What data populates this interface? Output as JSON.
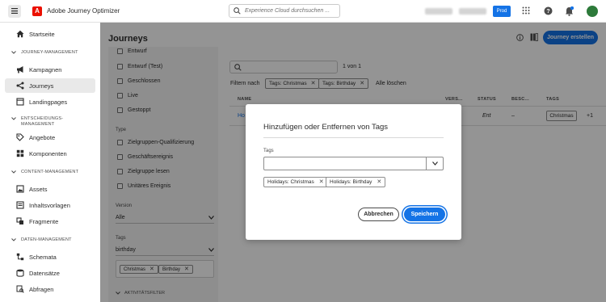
{
  "header": {
    "app_name": "Adobe Journey Optimizer",
    "search_placeholder": "Experience Cloud durchsuchen ...",
    "env_badge": "Prod"
  },
  "sidebar": {
    "home": "Startseite",
    "sections": [
      {
        "title": "JOURNEY-MANAGEMENT",
        "items": [
          "Kampagnen",
          "Journeys",
          "Landingpages"
        ]
      },
      {
        "title": "ENTSCHEIDUNGS-MANAGEMENT",
        "items": [
          "Angebote",
          "Komponenten"
        ]
      },
      {
        "title": "CONTENT-MANAGEMENT",
        "items": [
          "Assets",
          "Inhaltsvorlagen",
          "Fragmente"
        ]
      },
      {
        "title": "DATEN-MANAGEMENT",
        "items": [
          "Schemata",
          "Datensätze",
          "Abfragen"
        ]
      }
    ]
  },
  "page": {
    "title": "Journeys",
    "create_button": "Journey erstellen"
  },
  "filters": {
    "status_options": [
      "Entwurf",
      "Entwurf (Test)",
      "Geschlossen",
      "Live",
      "Gestoppt"
    ],
    "type_label": "Type",
    "type_options": [
      "Zielgruppen-Qualifizierung",
      "Geschäftsereignis",
      "Zielgruppe lesen",
      "Unitäres Ereignis"
    ],
    "version_label": "Version",
    "version_value": "Alle",
    "tags_label": "Tags",
    "tags_value": "birthday",
    "selected_tags": [
      "Christmas",
      "Birthday"
    ],
    "advanced_label": "AKTIVITÄTSFILTER"
  },
  "table": {
    "pagination": "1 von 1",
    "filter_by": "Filtern nach",
    "active_filters": [
      "Tags: Christmas",
      "Tags: Birthday"
    ],
    "clear_all": "Alle löschen",
    "headers": [
      "NAME",
      "VERS...",
      "STATUS",
      "BESC...",
      "TAGS"
    ],
    "row": {
      "name": "Ho",
      "status": "Ent",
      "description": "–",
      "tag": "Christmas",
      "more": "+1"
    }
  },
  "modal": {
    "title": "Hinzufügen oder Entfernen von Tags",
    "field_label": "Tags",
    "field_value": "",
    "tags": [
      "Holidays: Christmas",
      "Holidays: Birthday"
    ],
    "cancel": "Abbrechen",
    "save": "Speichern"
  },
  "colors": {
    "accent": "#1473e6",
    "brand": "#eb1000"
  }
}
